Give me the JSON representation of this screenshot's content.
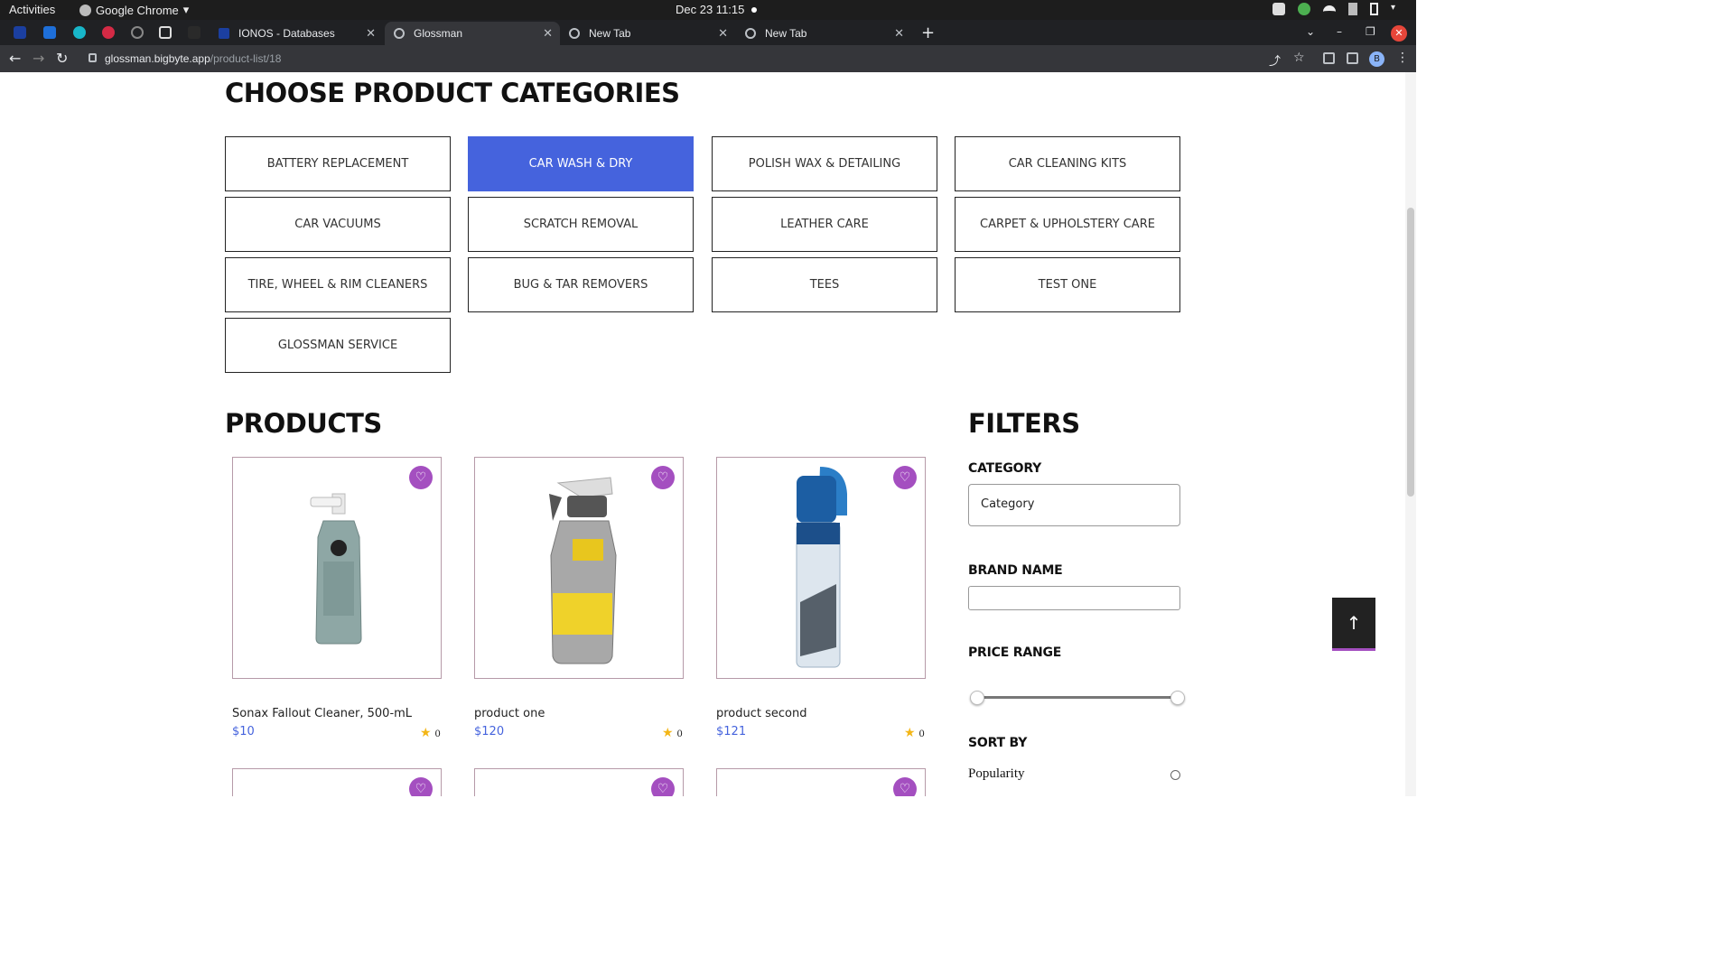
{
  "os": {
    "activities": "Activities",
    "app_name": "Google Chrome",
    "clock": "Dec 23  11:15"
  },
  "browser": {
    "tabs": [
      {
        "label": "IONOS - Databases",
        "favicon": "ionos-icon"
      },
      {
        "label": "Glossman",
        "favicon": "globe-icon",
        "active": true
      },
      {
        "label": "New Tab",
        "favicon": "globe-icon"
      },
      {
        "label": "New Tab",
        "favicon": "globe-icon"
      }
    ],
    "url_host": "glossman.bigbyte.app",
    "url_path": "/product-list/18",
    "profile_initial": "B"
  },
  "categories_section": {
    "title": "CHOOSE PRODUCT CATEGORIES",
    "items": [
      {
        "label": "BATTERY REPLACEMENT"
      },
      {
        "label": "CAR WASH & DRY",
        "active": true
      },
      {
        "label": "POLISH WAX & DETAILING"
      },
      {
        "label": "CAR CLEANING KITS"
      },
      {
        "label": "CAR VACUUMS"
      },
      {
        "label": "SCRATCH REMOVAL"
      },
      {
        "label": "LEATHER CARE"
      },
      {
        "label": "CARPET & UPHOLSTERY CARE"
      },
      {
        "label": "TIRE, WHEEL & RIM CLEANERS"
      },
      {
        "label": "BUG & TAR REMOVERS"
      },
      {
        "label": "TEES"
      },
      {
        "label": "TEST ONE"
      },
      {
        "label": "GLOSSMAN SERVICE"
      }
    ],
    "active_color": "#4563dd"
  },
  "products_section": {
    "title": "PRODUCTS",
    "items": [
      {
        "name": "Sonax Fallout Cleaner, 500-mL",
        "price": "$10",
        "rating": "0"
      },
      {
        "name": "product one",
        "price": "$120",
        "rating": "0"
      },
      {
        "name": "product second",
        "price": "$121",
        "rating": "0"
      }
    ],
    "accent": "#a44fc0"
  },
  "filters": {
    "title": "FILTERS",
    "category_label": "CATEGORY",
    "category_value": "Category",
    "brand_label": "BRAND NAME",
    "brand_value": "",
    "price_label": "PRICE RANGE",
    "sort_label": "SORT BY",
    "sort_option": "Popularity"
  }
}
